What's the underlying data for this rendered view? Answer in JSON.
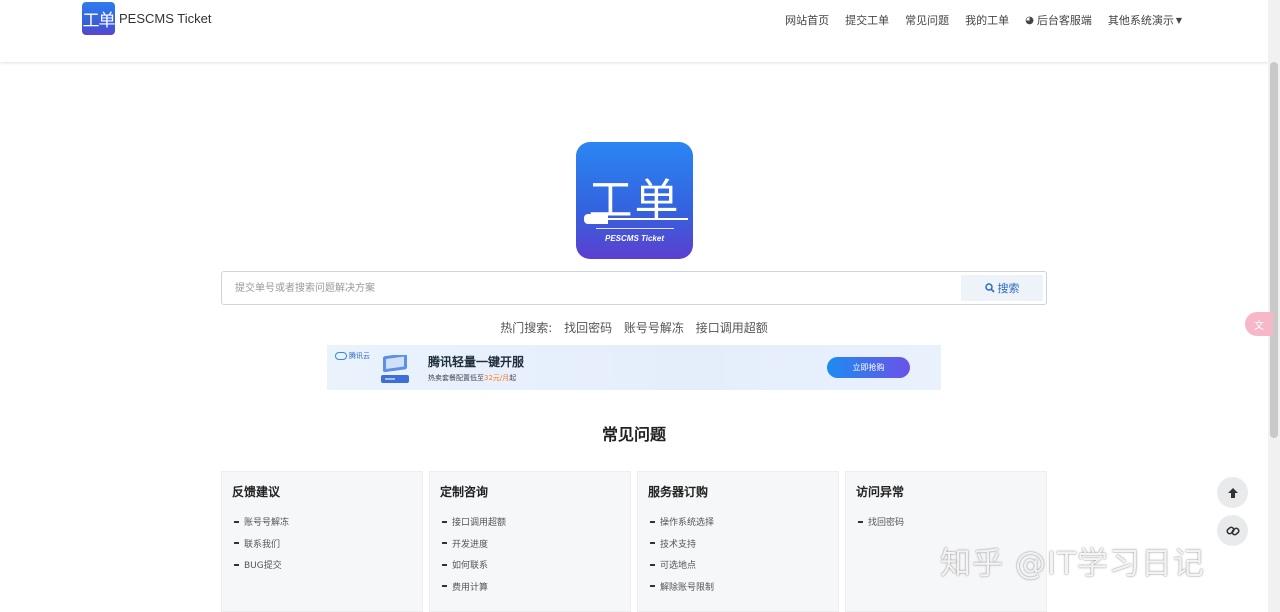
{
  "brand": {
    "logo_text": "工单",
    "name": "PESCMS Ticket"
  },
  "nav": {
    "items": [
      "网站首页",
      "提交工单",
      "常见问题",
      "我的工单"
    ],
    "admin": "后台客服端",
    "demo": "其他系统演示"
  },
  "hero": {
    "glyphs": "工单",
    "subtitle": "PESCMS Ticket"
  },
  "search": {
    "placeholder": "提交单号或者搜索问题解决方案",
    "button_label": "搜索"
  },
  "hot": {
    "label": "热门搜索:",
    "terms": [
      "找回密码",
      "账号号解冻",
      "接口调用超额"
    ]
  },
  "ad": {
    "brand": "腾讯云",
    "title": "腾讯轻量一键开服",
    "subtitle_prefix": "热卖套餐配置低至",
    "price": "32元/月",
    "subtitle_suffix": "起",
    "button": "立即抢购"
  },
  "faq": {
    "title": "常见问题",
    "categories": [
      {
        "title": "反馈建议",
        "items": [
          "账号号解冻",
          "联系我们",
          "BUG提交"
        ]
      },
      {
        "title": "定制咨询",
        "items": [
          "接口调用超额",
          "开发进度",
          "如何联系",
          "费用计算"
        ]
      },
      {
        "title": "服务器订购",
        "items": [
          "操作系统选择",
          "技术支持",
          "可选地点",
          "解除账号限制"
        ]
      },
      {
        "title": "访问异常",
        "items": [
          "找回密码"
        ]
      }
    ]
  },
  "watermark": "知乎 @IT学习日记",
  "colors": {
    "brand_blue": "#3561de",
    "accent_purple": "#5c3fd0",
    "link_blue": "#2d6cc0",
    "price_orange": "#ff7a1a"
  }
}
